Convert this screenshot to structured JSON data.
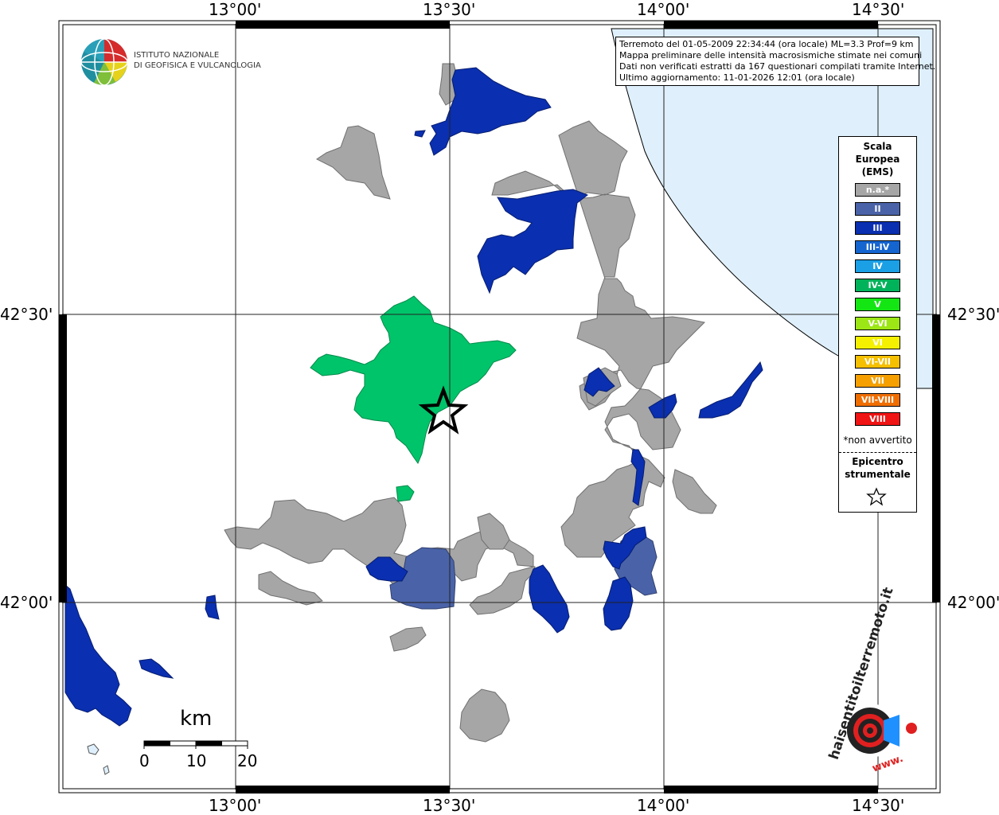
{
  "ticks": {
    "top": [
      "13°00'",
      "13°30'",
      "14°00'",
      "14°30'"
    ],
    "bottom": [
      "13°00'",
      "13°30'",
      "14°00'",
      "14°30'"
    ],
    "left": [
      "42°30'",
      "42°00'"
    ],
    "right": [
      "42°30'",
      "42°00'"
    ]
  },
  "institute": {
    "line1": "ISTITUTO NAZIONALE",
    "line2": "DI GEOFISICA E VULCANOLOGIA"
  },
  "info": {
    "line1": "Terremoto del 01-05-2009 22:34:44 (ora locale) ML=3.3 Prof=9 km",
    "line2": "Mappa preliminare delle intensità macrosismiche stimate nei comuni",
    "line3": "Dati non verificati estratti da 167 questionari compilati tramite Internet.",
    "line4": "Ultimo aggiornamento: 11-01-2026 12:01 (ora locale)"
  },
  "legend": {
    "title_line1": "Scala",
    "title_line2": "Europea",
    "title_line3": "(EMS)",
    "items": [
      {
        "label": "n.a.*",
        "color": "#a6a6a6"
      },
      {
        "label": "II",
        "color": "#4a63a8"
      },
      {
        "label": "III",
        "color": "#0a2fb0"
      },
      {
        "label": "III-IV",
        "color": "#1565d0"
      },
      {
        "label": "IV",
        "color": "#1ba0e6"
      },
      {
        "label": "IV-V",
        "color": "#00b35a"
      },
      {
        "label": "V",
        "color": "#14e614"
      },
      {
        "label": "V-VI",
        "color": "#9be614"
      },
      {
        "label": "VI",
        "color": "#f5f000"
      },
      {
        "label": "VI-VII",
        "color": "#f5c000"
      },
      {
        "label": "VII",
        "color": "#f5a000"
      },
      {
        "label": "VII-VIII",
        "color": "#f06e00"
      },
      {
        "label": "VIII",
        "color": "#f01414"
      }
    ],
    "note": "*non avvertito",
    "epicenter_line1": "Epicentro",
    "epicenter_line2": "strumentale"
  },
  "scale_bar": {
    "unit": "km",
    "labels": [
      "0",
      "10",
      "20"
    ]
  },
  "logo": {
    "text1": "haisentitoilterremoto.it",
    "text2": "www."
  },
  "colors": {
    "sea": "#dff0fc",
    "na": "#a6a6a6",
    "ii": "#4a63a8",
    "iii": "#0a2fb0",
    "iv_v": "#00c46a"
  }
}
